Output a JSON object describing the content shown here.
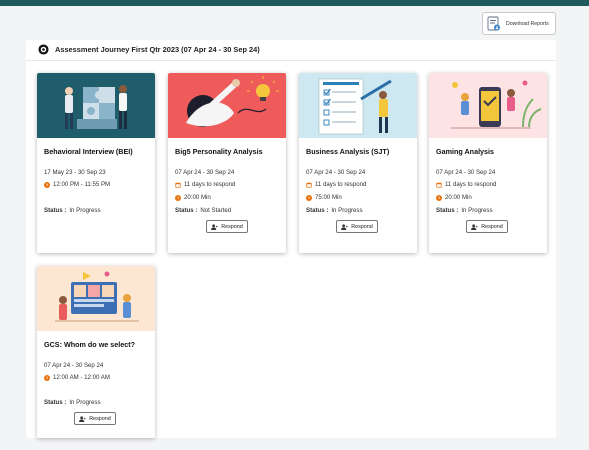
{
  "toolbar": {
    "download_label": "Download Reports"
  },
  "section": {
    "title": "Assessment Journey First Qtr 2023 (07 Apr 24 - 30 Sep 24)"
  },
  "cards": [
    {
      "title": "Behavioral Interview (BEI)",
      "dates": "17 May 23 - 30 Sep 23",
      "time": "12:00 PM - 11:55 PM",
      "status_label": "Status :",
      "status": "In Progress"
    },
    {
      "title": "Big5 Personality Analysis",
      "dates": "07 Apr 24 - 30 Sep 24",
      "respond_days": "11 days to respond",
      "duration": "20:00 Min",
      "status_label": "Status :",
      "status": "Not Started",
      "respond_label": "Respond"
    },
    {
      "title": "Business Analysis (SJT)",
      "dates": "07 Apr 24 - 30 Sep 24",
      "respond_days": "11 days to respond",
      "duration": "75:00 Min",
      "status_label": "Status :",
      "status": "In Progress",
      "respond_label": "Respond"
    },
    {
      "title": "Gaming Analysis",
      "dates": "07 Apr 24 - 30 Sep 24",
      "respond_days": "11 days to respond",
      "duration": "20:00 Min",
      "status_label": "Status :",
      "status": "In Progress",
      "respond_label": "Respond"
    },
    {
      "title": "GCS: Whom do we select?",
      "dates": "07 Apr 24 - 30 Sep 24",
      "time": "12:00 AM - 12:00 AM",
      "status_label": "Status :",
      "status": "In Progress",
      "respond_label": "Respond"
    }
  ],
  "colors": {
    "topbar": "#1f5a5e",
    "clock_icon": "#e8710a",
    "calendar_icon": "#e8710a"
  },
  "icons": {
    "download": "report-download-icon",
    "section": "journey-icon",
    "clock": "clock-icon",
    "calendar": "calendar-icon",
    "respond": "user-add-icon"
  }
}
